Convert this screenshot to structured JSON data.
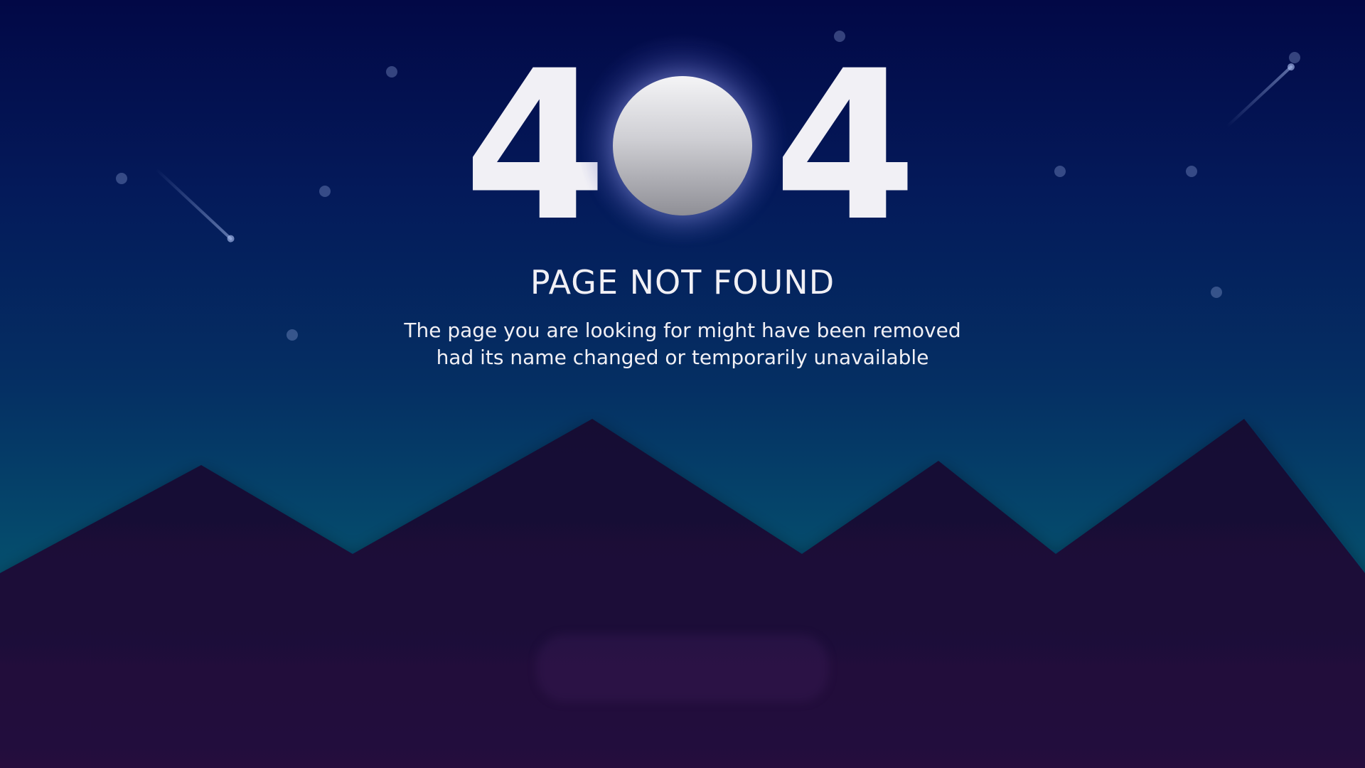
{
  "error": {
    "digit_left": "4",
    "digit_right": "4",
    "title": "PAGE NOT FOUND",
    "description_line1": "The page you are looking for might have been removed",
    "description_line2": "had its name changed or temporarily unavailable"
  },
  "icons": {
    "moon": "moon-icon",
    "stars": "star-icon",
    "meteors": "meteor-icon",
    "mountains": "mountain-range"
  },
  "colors": {
    "sky_top": "#020846",
    "sky_bottom": "#0a5f74",
    "mountain": "#1c1339",
    "text": "#f1f0f5"
  }
}
